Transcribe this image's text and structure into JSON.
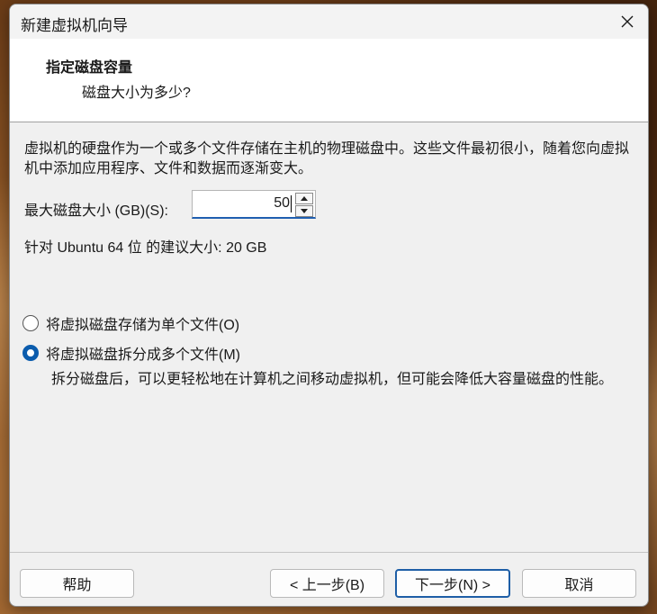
{
  "window": {
    "title": "新建虚拟机向导",
    "close_icon": "close-icon"
  },
  "header": {
    "title": "指定磁盘容量",
    "subtitle": "磁盘大小为多少?"
  },
  "content": {
    "description": "虚拟机的硬盘作为一个或多个文件存储在主机的物理磁盘中。这些文件最初很小，随着您向虚拟机中添加应用程序、文件和数据而逐渐变大。",
    "max_size_label": "最大磁盘大小 (GB)(S):",
    "max_size_value": "50",
    "recommended": "针对 Ubuntu 64 位 的建议大小: 20 GB",
    "radio_single": "将虚拟磁盘存储为单个文件(O)",
    "radio_split": "将虚拟磁盘拆分成多个文件(M)",
    "selected_option": "radio_split",
    "split_description": "拆分磁盘后，可以更轻松地在计算机之间移动虚拟机，但可能会降低大容量磁盘的性能。"
  },
  "footer": {
    "help": "帮助",
    "back": "< 上一步(B)",
    "next": "下一步(N) >",
    "cancel": "取消"
  },
  "colors": {
    "accent": "#0b5cad",
    "default_button_border": "#1e5ea6"
  }
}
